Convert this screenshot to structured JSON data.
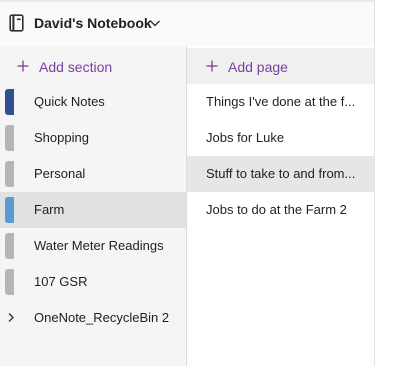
{
  "notebook": {
    "title": "David's Notebook",
    "icon": "notebook-icon",
    "chevron_icon": "chevron-down-icon"
  },
  "sections_pane": {
    "add_label": "Add section",
    "add_icon": "plus-icon",
    "items": [
      {
        "label": "Quick Notes",
        "tab_color": "#2f4f8f",
        "selected": false
      },
      {
        "label": "Shopping",
        "tab_color": "#b5b5b5",
        "selected": false
      },
      {
        "label": "Personal",
        "tab_color": "#b5b5b5",
        "selected": false
      },
      {
        "label": "Farm",
        "tab_color": "#5b9bd5",
        "selected": true
      },
      {
        "label": "Water Meter Readings",
        "tab_color": "#b5b5b5",
        "selected": false
      },
      {
        "label": "107 GSR",
        "tab_color": "#b5b5b5",
        "selected": false
      }
    ],
    "group": {
      "label": "OneNote_RecycleBin 2",
      "icon": "chevron-right-icon"
    }
  },
  "pages_pane": {
    "add_label": "Add page",
    "add_icon": "plus-icon",
    "items": [
      {
        "label": "Things I've done at the f...",
        "selected": false
      },
      {
        "label": "Jobs for Luke",
        "selected": false
      },
      {
        "label": "Stuff to take to and from...",
        "selected": true
      },
      {
        "label": "Jobs to do at the Farm 2",
        "selected": false
      }
    ]
  },
  "colors": {
    "accent": "#7b3fa0",
    "selected_section_bg": "#e1e1e1",
    "selected_page_bg": "#e6e6e6",
    "pane_bg": "#f5f5f5"
  }
}
